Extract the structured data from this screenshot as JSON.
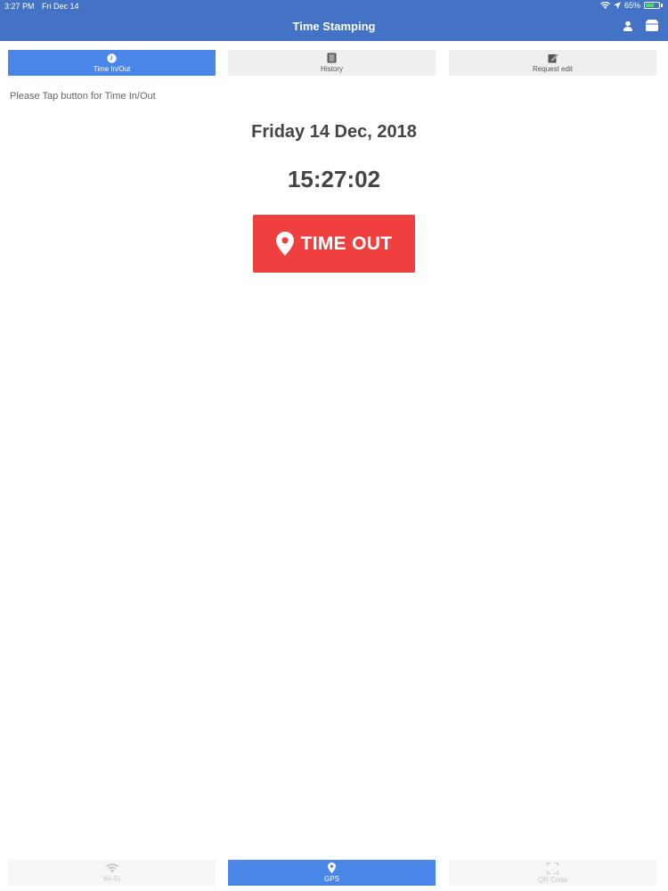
{
  "status_bar": {
    "time": "3:27 PM",
    "date": "Fri Dec 14",
    "battery": "65%",
    "battery_level": 0.65
  },
  "nav": {
    "title": "Time Stamping",
    "icons": [
      "person-icon",
      "wallet-icon"
    ]
  },
  "tabs": [
    {
      "label": "Time In/Out",
      "icon": "clock-icon",
      "active": true
    },
    {
      "label": "History",
      "icon": "book-icon",
      "active": false
    },
    {
      "label": "Request edit",
      "icon": "edit-icon",
      "active": false
    }
  ],
  "main": {
    "hint": "Please Tap button for Time In/Out",
    "date": "Friday 14 Dec, 2018",
    "clock": "15:27:02",
    "action_label": "TIME OUT"
  },
  "bottom_tabs": [
    {
      "label": "Wi-Fi",
      "icon": "wifi-icon",
      "active": false
    },
    {
      "label": "GPS",
      "icon": "location-pin-icon",
      "active": true
    },
    {
      "label": "QR Code",
      "icon": "qr-scan-icon",
      "active": false
    }
  ],
  "colors": {
    "nav_bg": "#4472c4",
    "accent": "#4a86e8",
    "danger": "#ef3f3f"
  }
}
